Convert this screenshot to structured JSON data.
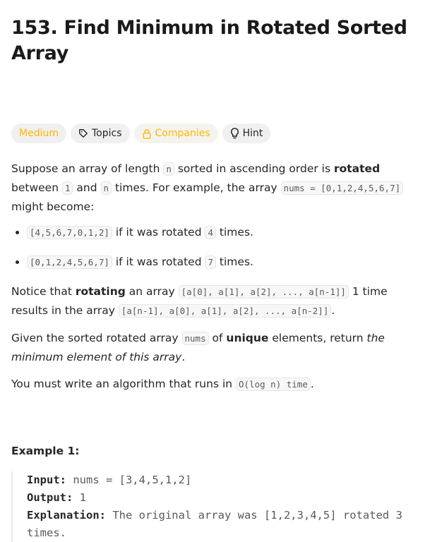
{
  "title": "153. Find Minimum in Rotated Sorted Array",
  "tags": {
    "difficulty": "Medium",
    "topics": "Topics",
    "companies": "Companies",
    "hint": "Hint"
  },
  "colors": {
    "medium": "#ffb800",
    "code_bg": "#f7f7f8"
  },
  "p1": {
    "a": "Suppose an array of length ",
    "c1": "n",
    "b": " sorted in ascending order is ",
    "bold": "rotated",
    "c": " between ",
    "c2": "1",
    "d": " and ",
    "c3": "n",
    "e": " times. For example, the array ",
    "c4": "nums = [0,1,2,4,5,6,7]",
    "f": " might become:"
  },
  "bullets": [
    {
      "code": "[4,5,6,7,0,1,2]",
      "a": " if it was rotated ",
      "n": "4",
      "b": " times."
    },
    {
      "code": "[0,1,2,4,5,6,7]",
      "a": " if it was rotated ",
      "n": "7",
      "b": " times."
    }
  ],
  "p2": {
    "a": "Notice that ",
    "bold": "rotating",
    "b": " an array ",
    "c1": "[a[0], a[1], a[2], ..., a[n-1]]",
    "c": " 1 time results in the array ",
    "c2": "[a[n-1], a[0], a[1], a[2], ..., a[n-2]]",
    "d": "."
  },
  "p3": {
    "a": "Given the sorted rotated array ",
    "c1": "nums",
    "b": " of ",
    "bold": "unique",
    "c": " elements, return ",
    "em": "the minimum element of this array",
    "d": "."
  },
  "p4": {
    "a": "You must write an algorithm that runs in ",
    "c1": "O(log n) time",
    "b": "."
  },
  "example": {
    "heading": "Example 1:",
    "input_label": "Input:",
    "input": " nums = [3,4,5,1,2]",
    "output_label": "Output:",
    "output": " 1",
    "explanation_label": "Explanation:",
    "explanation": " The original array was [1,2,3,4,5] rotated 3 times."
  }
}
